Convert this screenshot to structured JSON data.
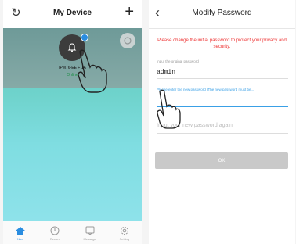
{
  "left": {
    "title": "My Device",
    "device": {
      "name": "IPM76-EE F 1A",
      "status": "Online"
    },
    "tabs": [
      {
        "label": "Now",
        "active": true
      },
      {
        "label": "Record",
        "active": false
      },
      {
        "label": "Message",
        "active": false
      },
      {
        "label": "Setting",
        "active": false
      }
    ]
  },
  "right": {
    "title": "Modify Password",
    "banner": "Please change the initial password to protect your privacy and security.",
    "original_label": "Input the original password",
    "original_value": "admin",
    "new_label": "Please enter the new password (The new password must be...",
    "again_placeholder": "Input your new password again",
    "ok_label": "OK"
  },
  "colors": {
    "accent": "#3aa0e6",
    "warning": "#ee3333",
    "teal": "#6fd3cc"
  }
}
